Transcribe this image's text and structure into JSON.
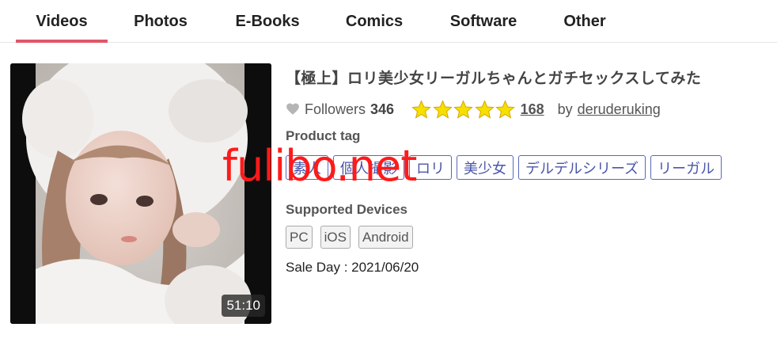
{
  "tabs": [
    {
      "label": "Videos",
      "active": true
    },
    {
      "label": "Photos",
      "active": false
    },
    {
      "label": "E-Books",
      "active": false
    },
    {
      "label": "Comics",
      "active": false
    },
    {
      "label": "Software",
      "active": false
    },
    {
      "label": "Other",
      "active": false
    }
  ],
  "product": {
    "title": "【極上】ロリ美少女リーガルちゃんとガチセックスしてみた",
    "duration": "51:10",
    "followers_label": "Followers",
    "followers_count": "346",
    "rating_stars": 5,
    "review_count": "168",
    "by_label": "by",
    "author": "deruderuking",
    "tag_heading": "Product tag",
    "tags": [
      "素人",
      "個人撮影",
      "ロリ",
      "美少女",
      "デルデルシリーズ",
      "リーガル"
    ],
    "devices_heading": "Supported Devices",
    "devices": [
      "PC",
      "iOS",
      "Android"
    ],
    "sale_day": "Sale Day : 2021/06/20"
  },
  "watermark": "fulibo.net",
  "colors": {
    "accent": "#e0566a",
    "tag_border": "#5a67b8",
    "star": "#f5e000",
    "watermark": "#ff1a1a"
  },
  "icons": {
    "heart": "heart-icon",
    "star": "star-icon"
  }
}
